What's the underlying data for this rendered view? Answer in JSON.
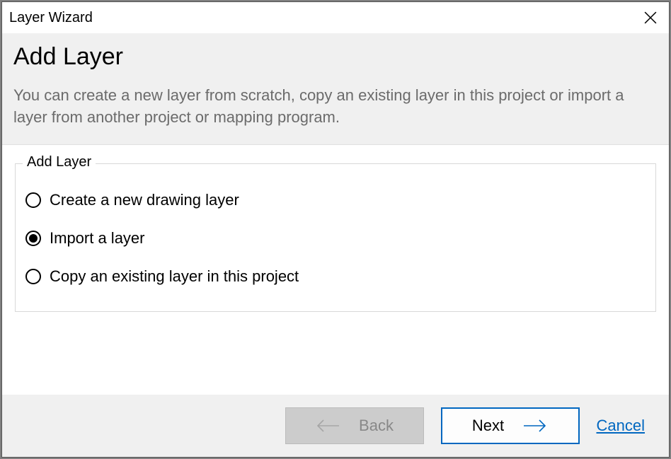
{
  "window": {
    "title": "Layer Wizard"
  },
  "page": {
    "heading": "Add Layer",
    "description": "You can create a new layer from scratch, copy an existing layer in this project or import a layer from another project or mapping program."
  },
  "group": {
    "legend": "Add Layer",
    "options": [
      {
        "label": "Create a new drawing layer",
        "selected": false
      },
      {
        "label": "Import a layer",
        "selected": true
      },
      {
        "label": "Copy an existing layer in this project",
        "selected": false
      }
    ]
  },
  "footer": {
    "back": "Back",
    "next": "Next",
    "cancel": "Cancel"
  }
}
